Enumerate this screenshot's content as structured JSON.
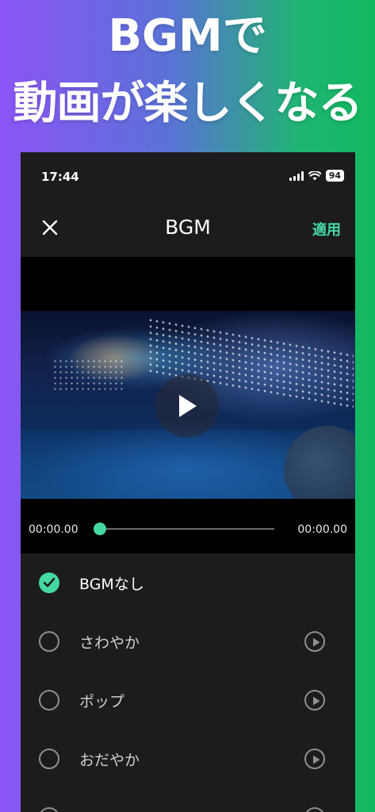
{
  "promo": {
    "line1": "BGMで",
    "line2": "動画が楽しくなる"
  },
  "status_bar": {
    "time": "17:44",
    "battery": "94"
  },
  "nav": {
    "title": "BGM",
    "apply_label": "適用",
    "close_icon": "close-icon"
  },
  "player": {
    "start_time": "00:00.00",
    "end_time": "00:00.00",
    "progress": 0
  },
  "bgm_options": [
    {
      "label": "BGMなし",
      "selected": true,
      "has_preview": false
    },
    {
      "label": "さわやか",
      "selected": false,
      "has_preview": true
    },
    {
      "label": "ポップ",
      "selected": false,
      "has_preview": true
    },
    {
      "label": "おだやか",
      "selected": false,
      "has_preview": true
    },
    {
      "label": "",
      "selected": false,
      "has_preview": true
    }
  ],
  "colors": {
    "accent": "#45d9a2",
    "background": "#1c1c1e",
    "gradient_left": "#8c54f5",
    "gradient_right": "#12b85f"
  }
}
